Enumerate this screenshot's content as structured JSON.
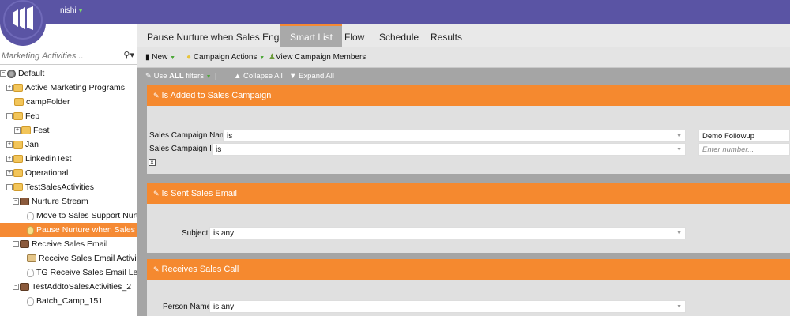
{
  "header": {
    "username": "nishi"
  },
  "tabs": [
    {
      "label": "Pause Nurture when Sales Engages"
    },
    {
      "label": "Smart List"
    },
    {
      "label": "Flow"
    },
    {
      "label": "Schedule"
    },
    {
      "label": "Results"
    }
  ],
  "sidebar": {
    "search_placeholder": "Marketing Activities...",
    "tree": [
      {
        "label": "Default"
      },
      {
        "label": "Active Marketing Programs"
      },
      {
        "label": "campFolder"
      },
      {
        "label": "Feb"
      },
      {
        "label": "Fest"
      },
      {
        "label": "Jan"
      },
      {
        "label": "LinkedinTest"
      },
      {
        "label": "Operational"
      },
      {
        "label": "TestSalesActivities"
      },
      {
        "label": "Nurture Stream"
      },
      {
        "label": "Move to Sales Support Nurture"
      },
      {
        "label": "Pause Nurture when Sales Engag"
      },
      {
        "label": "Receive Sales Email"
      },
      {
        "label": "Receive Sales Email Activity - Lea"
      },
      {
        "label": "TG Receive Sales Email Leads"
      },
      {
        "label": "TestAddtoSalesActivities_2"
      },
      {
        "label": "Batch_Camp_151"
      }
    ]
  },
  "toolbar": {
    "new_label": "New",
    "campaign_actions_label": "Campaign Actions",
    "view_members_label": "View Campaign Members"
  },
  "filterbar": {
    "use_prefix": "Use",
    "use_all": "ALL",
    "use_suffix": "filters",
    "separator": "|",
    "collapse_all": "Collapse All",
    "expand_all": "Expand All"
  },
  "filters": [
    {
      "title": "Is Added to Sales Campaign",
      "rows": [
        {
          "label": "Sales Campaign Name:",
          "operator": "is",
          "value": "Demo Followup"
        },
        {
          "label": "Sales Campaign ID:",
          "operator": "is",
          "placeholder": "Enter number..."
        }
      ]
    },
    {
      "title": "Is Sent Sales Email",
      "rows": [
        {
          "label": "Subject:",
          "operator": "is any"
        }
      ]
    },
    {
      "title": "Receives Sales Call",
      "rows": [
        {
          "label": "Person Name:",
          "operator": "is any"
        }
      ]
    }
  ],
  "colors": {
    "header": "#5a54a4",
    "accent": "#f58a34",
    "panel": "#a5a5a5"
  }
}
